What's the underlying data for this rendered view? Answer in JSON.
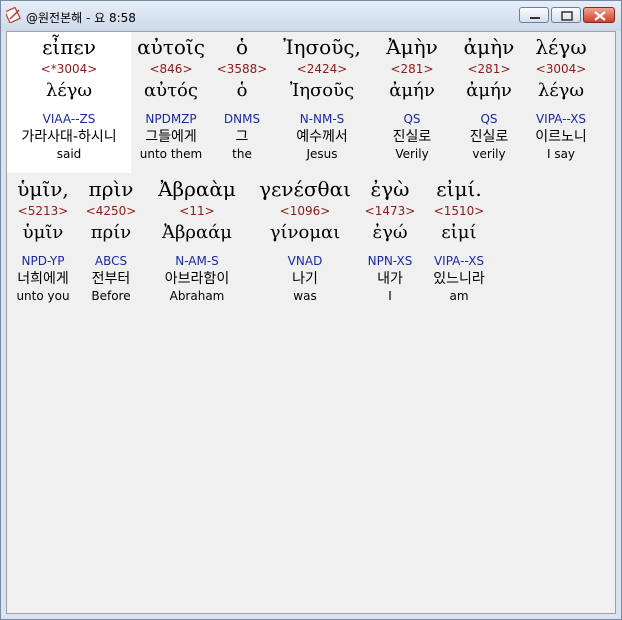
{
  "window": {
    "title": "@원전본해 - 요 8:58"
  },
  "rows": [
    {
      "words": [
        {
          "greek": "εἶπεν",
          "strong": "<*3004>",
          "lemma": "λέγω",
          "parse": "VIAA--ZS",
          "korean": "가라사대-하시니",
          "english": "said"
        },
        {
          "greek": "αὐτοῖς",
          "strong": "<846>",
          "lemma": "αὐτός",
          "parse": "NPDMZP",
          "korean": "그들에게",
          "english": "unto them"
        },
        {
          "greek": "ὁ",
          "strong": "<3588>",
          "lemma": "ὁ",
          "parse": "DNMS",
          "korean": "그",
          "english": "the"
        },
        {
          "greek": "Ἰησοῦς,",
          "strong": "<2424>",
          "lemma": "Ἰησοῦς",
          "parse": "N-NM-S",
          "korean": "예수께서",
          "english": "Jesus"
        },
        {
          "greek": "Ἀμὴν",
          "strong": "<281>",
          "lemma": "ἀμήν",
          "parse": "QS",
          "korean": "진실로",
          "english": "Verily"
        },
        {
          "greek": "ἀμὴν",
          "strong": "<281>",
          "lemma": "ἀμήν",
          "parse": "QS",
          "korean": "진실로",
          "english": "verily"
        },
        {
          "greek": "λέγω",
          "strong": "<3004>",
          "lemma": "λέγω",
          "parse": "VIPA--XS",
          "korean": "이르노니",
          "english": "I say"
        }
      ]
    },
    {
      "words": [
        {
          "greek": "ὑμῖν,",
          "strong": "<5213>",
          "lemma": "ὑμῖν",
          "parse": "NPD-YP",
          "korean": "너희에게",
          "english": "unto you"
        },
        {
          "greek": "πρὶν",
          "strong": "<4250>",
          "lemma": "πρίν",
          "parse": "ABCS",
          "korean": "전부터",
          "english": "Before"
        },
        {
          "greek": "Ἀβραὰμ",
          "strong": "<11>",
          "lemma": "Ἀβραάμ",
          "parse": "N-AM-S",
          "korean": "아브라함이",
          "english": "Abraham"
        },
        {
          "greek": "γενέσθαι",
          "strong": "<1096>",
          "lemma": "γίνομαι",
          "parse": "VNAD",
          "korean": "나기",
          "english": "was"
        },
        {
          "greek": "ἐγὼ",
          "strong": "<1473>",
          "lemma": "ἐγώ",
          "parse": "NPN-XS",
          "korean": "내가",
          "english": "I"
        },
        {
          "greek": "εἰμί.",
          "strong": "<1510>",
          "lemma": "εἰμί",
          "parse": "VIPA--XS",
          "korean": "있느니라",
          "english": "am"
        }
      ]
    }
  ]
}
